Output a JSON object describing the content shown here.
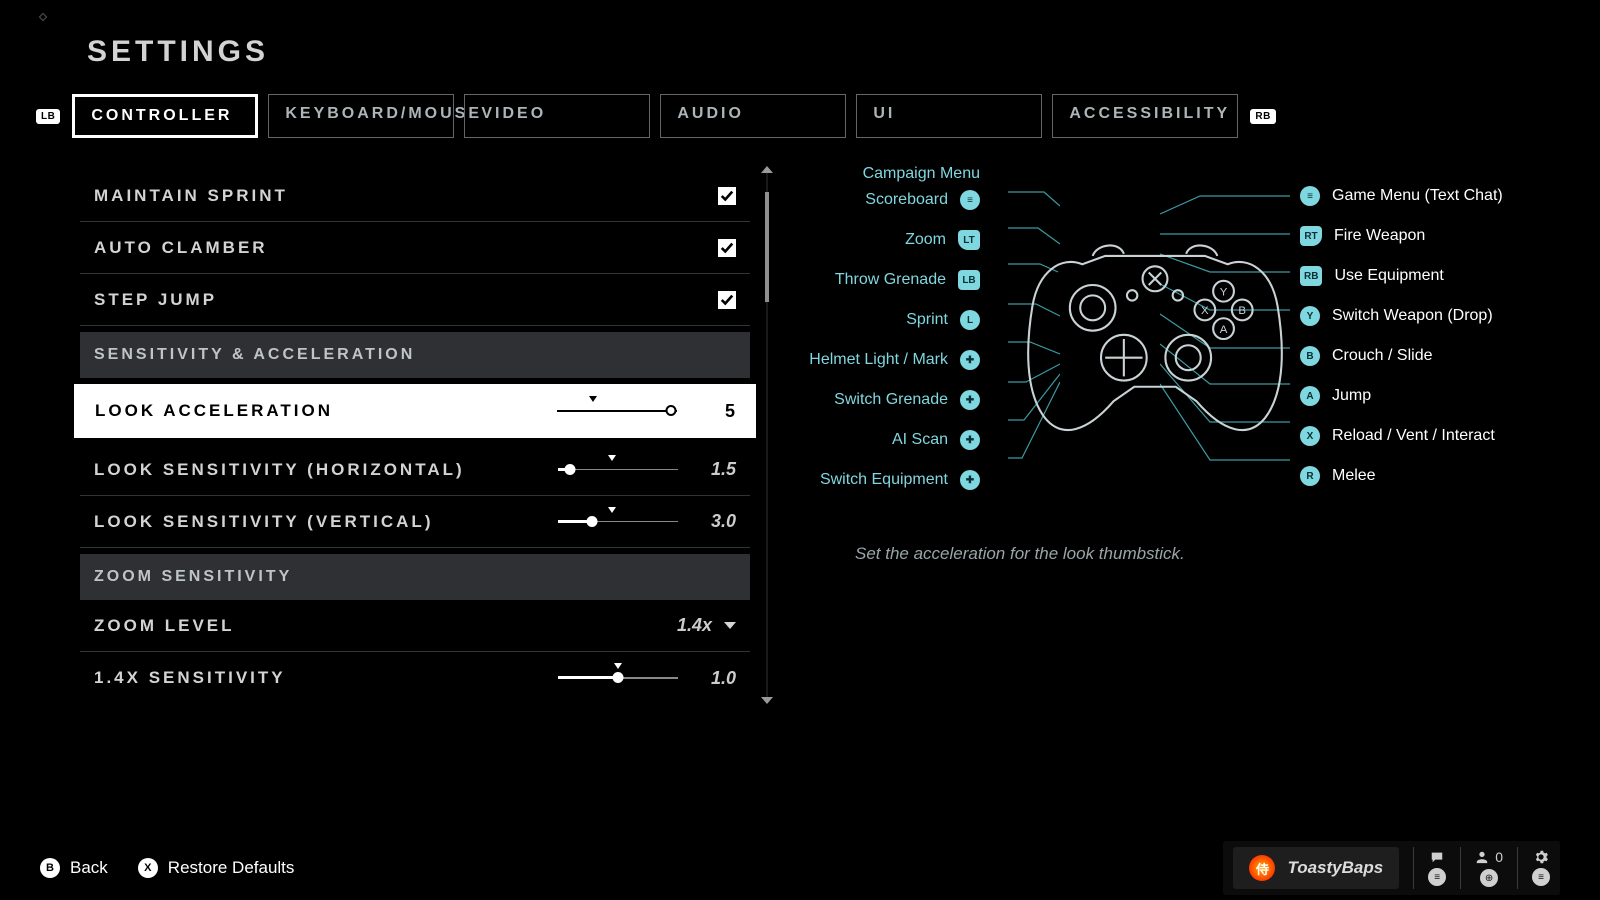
{
  "title": "SETTINGS",
  "bumpers": {
    "left": "LB",
    "right": "RB"
  },
  "tabs": [
    "CONTROLLER",
    "KEYBOARD/MOUSE",
    "VIDEO",
    "AUDIO",
    "UI",
    "ACCESSIBILITY"
  ],
  "active_tab_index": 0,
  "settings": {
    "checkboxes": [
      {
        "label": "MAINTAIN SPRINT",
        "checked": true
      },
      {
        "label": "AUTO CLAMBER",
        "checked": true
      },
      {
        "label": "STEP JUMP",
        "checked": true
      }
    ],
    "section1": "SENSITIVITY & ACCELERATION",
    "look_accel": {
      "label": "LOOK ACCELERATION",
      "value": "5",
      "fill_pct": 95,
      "default_pct": 30
    },
    "look_h": {
      "label": "LOOK SENSITIVITY (HORIZONTAL)",
      "value": "1.5",
      "fill_pct": 10,
      "default_pct": 45
    },
    "look_v": {
      "label": "LOOK SENSITIVITY (VERTICAL)",
      "value": "3.0",
      "fill_pct": 28,
      "default_pct": 45
    },
    "section2": "ZOOM SENSITIVITY",
    "zoom_level": {
      "label": "ZOOM LEVEL",
      "value": "1.4x"
    },
    "zoom_sens": {
      "label": "1.4X SENSITIVITY",
      "value": "1.0",
      "fill_pct": 50,
      "default_pct": 50
    }
  },
  "controller_map": {
    "left": [
      {
        "label": "Campaign Menu",
        "btn": ""
      },
      {
        "label": "Scoreboard",
        "btn": "≡"
      },
      {
        "label": "Zoom",
        "btn": "LT"
      },
      {
        "label": "Throw Grenade",
        "btn": "LB"
      },
      {
        "label": "Sprint",
        "btn": "L"
      },
      {
        "label": "Helmet Light / Mark",
        "btn": "✚"
      },
      {
        "label": "Switch Grenade",
        "btn": "✚"
      },
      {
        "label": "AI Scan",
        "btn": "✚"
      },
      {
        "label": "Switch Equipment",
        "btn": "✚"
      }
    ],
    "right": [
      {
        "btn": "≡",
        "label": "Game Menu (Text Chat)"
      },
      {
        "btn": "RT",
        "label": "Fire Weapon"
      },
      {
        "btn": "RB",
        "label": "Use Equipment"
      },
      {
        "btn": "Y",
        "label": "Switch Weapon (Drop)"
      },
      {
        "btn": "B",
        "label": "Crouch / Slide"
      },
      {
        "btn": "A",
        "label": "Jump"
      },
      {
        "btn": "X",
        "label": "Reload / Vent / Interact"
      },
      {
        "btn": "R",
        "label": "Melee"
      }
    ]
  },
  "description": "Set the acceleration for the look thumbstick.",
  "footer": {
    "back": {
      "key": "B",
      "label": "Back"
    },
    "restore": {
      "key": "X",
      "label": "Restore Defaults"
    },
    "username": "ToastyBaps",
    "party_count": "0"
  }
}
